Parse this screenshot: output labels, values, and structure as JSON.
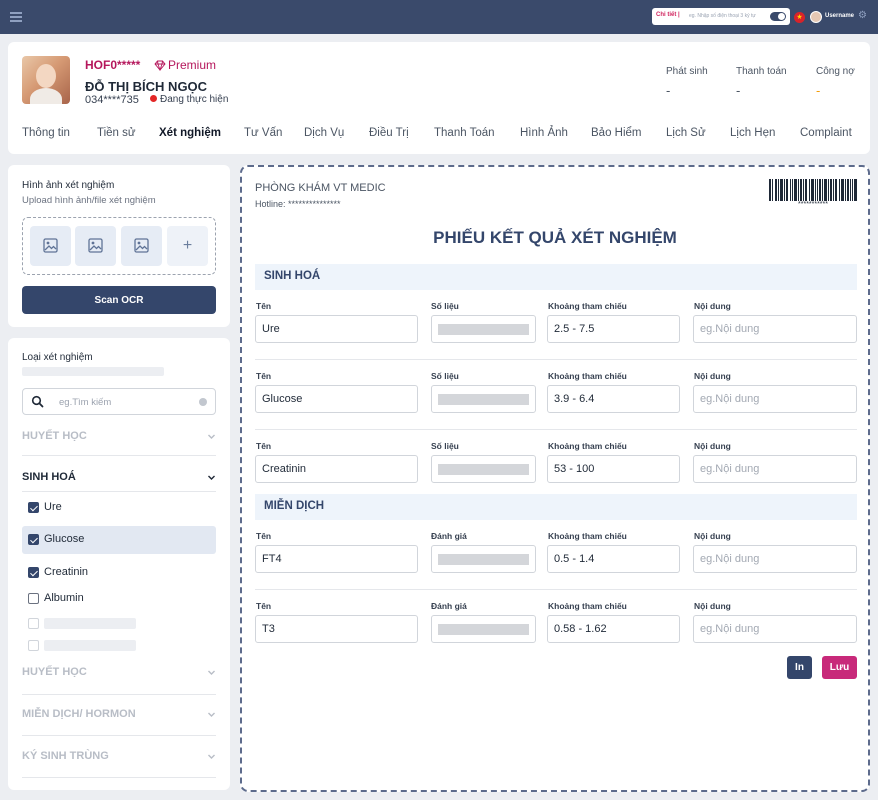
{
  "topbar": {
    "search_label": "Chi tiết |",
    "search_placeholder": "eg. Nhập số điện thoại 3 ký tự",
    "username": "Username",
    "flag_glyph": "★",
    "gear_glyph": "⚙"
  },
  "patient": {
    "code": "HOF0*****",
    "tier": "Premium",
    "name": "ĐỖ THỊ BÍCH NGỌC",
    "phone": "034****735",
    "status": "Đang thực hiện",
    "status_color": "#e32626"
  },
  "stats": [
    {
      "label": "Phát sinh",
      "value": "-"
    },
    {
      "label": "Thanh toán",
      "value": "-"
    },
    {
      "label": "Công nợ",
      "value": "-"
    }
  ],
  "tabs": [
    "Thông tin",
    "Tiền sử",
    "Xét nghiệm",
    "Tư Vấn",
    "Dịch Vụ",
    "Điều Trị",
    "Thanh Toán",
    "Hình Ảnh",
    "Bảo Hiểm",
    "Lịch Sử",
    "Lịch Hẹn",
    "Complaint"
  ],
  "active_tab": "Xét nghiệm",
  "upload_panel": {
    "title": "Hình ảnh xét nghiệm",
    "subtitle": "Upload hình ảnh/file xét nghiệm",
    "add_glyph": "+",
    "scan_label": "Scan OCR"
  },
  "test_panel": {
    "title": "Loại xét nghiệm",
    "search_placeholder": "eg.Tìm kiếm",
    "groups_top": [
      {
        "label": "HUYẾT HỌC"
      },
      {
        "label": "SINH HOÁ"
      }
    ],
    "items": [
      {
        "label": "Ure",
        "checked": true
      },
      {
        "label": "Glucose",
        "checked": true
      },
      {
        "label": "Creatinin",
        "checked": true
      },
      {
        "label": "Albumin",
        "checked": false
      }
    ],
    "groups_bottom": [
      {
        "label": "HUYẾT HỌC"
      },
      {
        "label": "MIỄN DỊCH/ HORMON"
      },
      {
        "label": "KÝ SINH TRÙNG"
      }
    ]
  },
  "sheet": {
    "clinic": "PHÒNG KHÁM VT MEDIC",
    "hotline": "Hotline: ***************",
    "barcode_number": "***********",
    "title": "PHIẾU KẾT QUẢ XÉT NGHIỆM",
    "sections": [
      {
        "title": "SINH HOÁ",
        "col_labels": [
          "Tên",
          "Số liệu",
          "Khoảng tham chiếu",
          "Nội dung"
        ],
        "rows": [
          {
            "name": "Ure",
            "range": "2.5 - 7.5",
            "note_placeholder": "eg.Nội dung"
          },
          {
            "name": "Glucose",
            "range": "3.9 - 6.4",
            "note_placeholder": "eg.Nội dung"
          },
          {
            "name": "Creatinin",
            "range": "53 - 100",
            "note_placeholder": "eg.Nội dung"
          }
        ]
      },
      {
        "title": "MIỄN DỊCH",
        "col_labels": [
          "Tên",
          "Đánh giá",
          "Khoảng tham chiếu",
          "Nội dung"
        ],
        "rows": [
          {
            "name": "FT4",
            "range": "0.5 - 1.4",
            "note_placeholder": "eg.Nội dung"
          },
          {
            "name": "T3",
            "range": "0.58 - 1.62",
            "note_placeholder": "eg.Nội dung"
          }
        ]
      }
    ],
    "print_label": "In",
    "save_label": "Lưu"
  }
}
